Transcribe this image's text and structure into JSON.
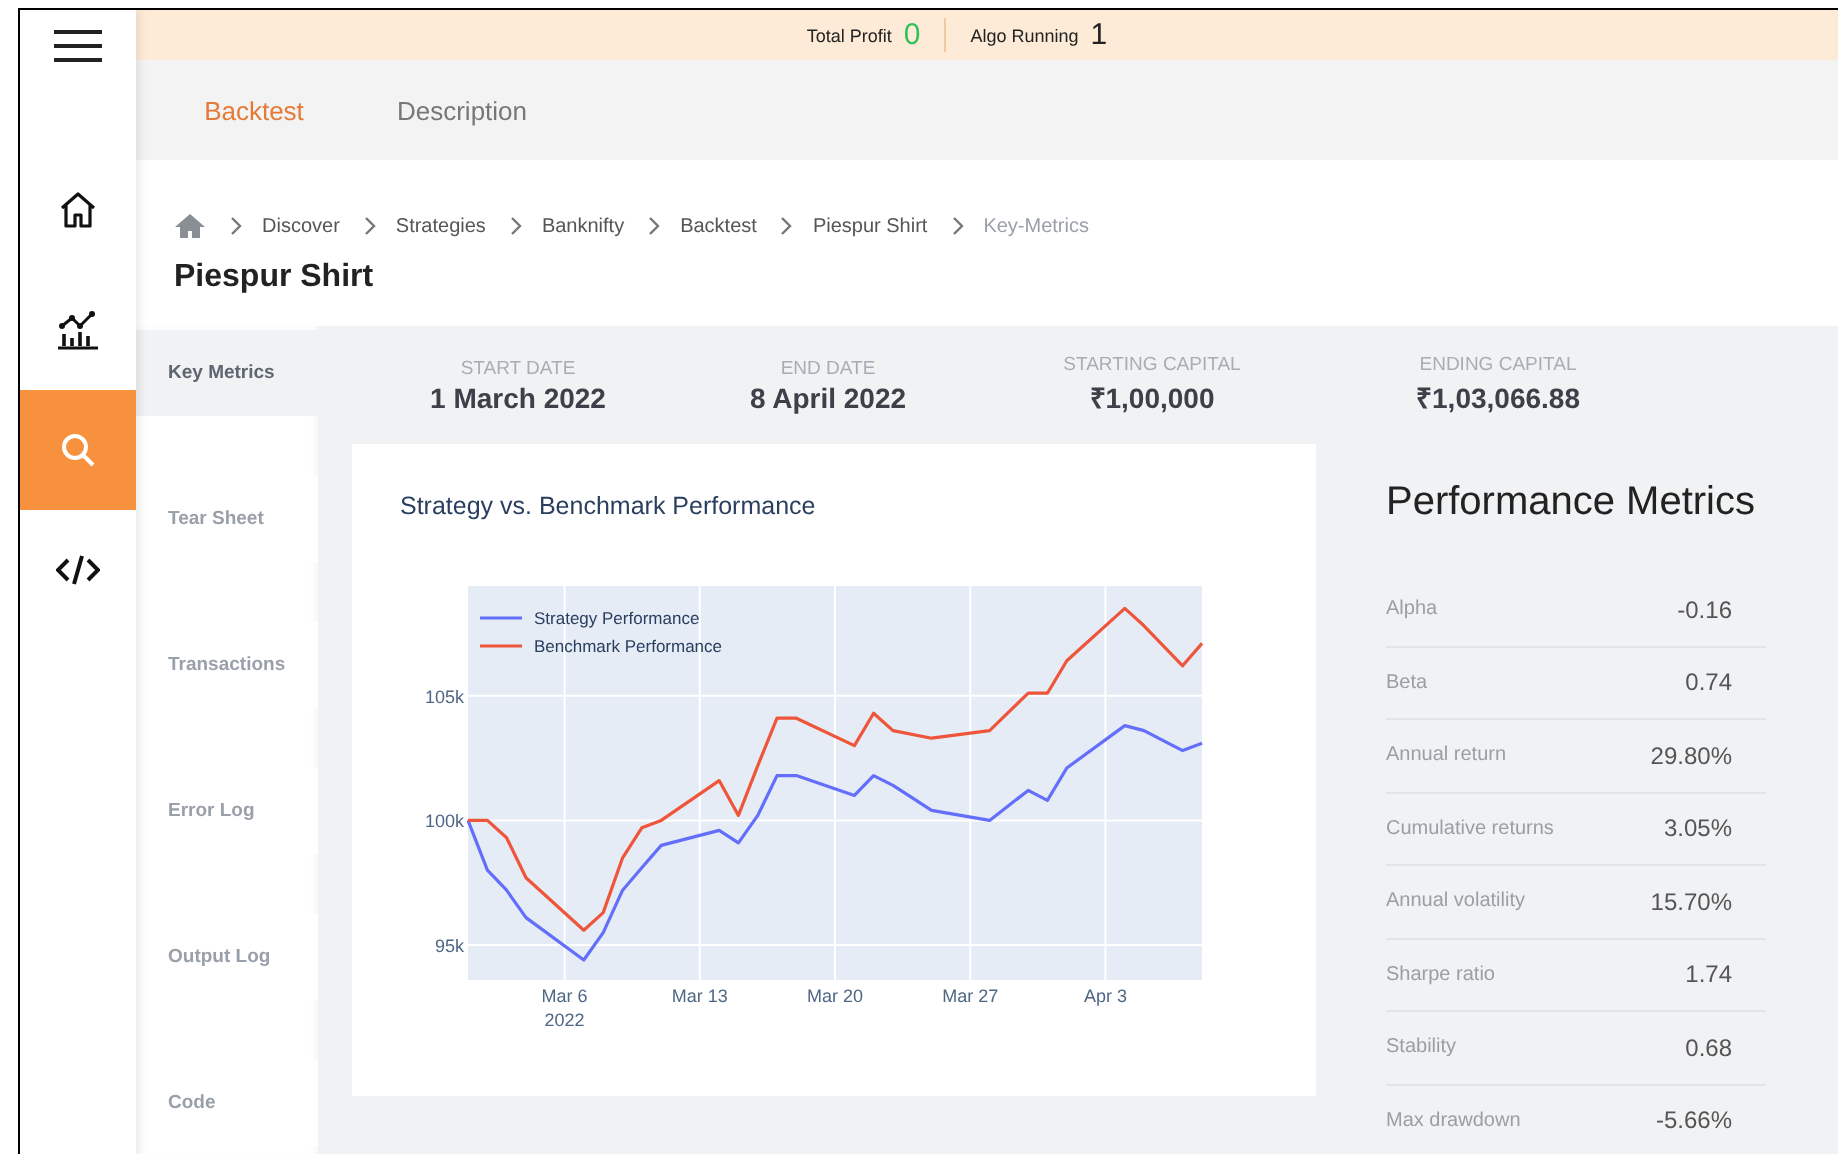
{
  "top_bar": {
    "stats": [
      {
        "label": "Total Profit",
        "value": "0",
        "kind": "profit"
      },
      {
        "label": "Algo Running",
        "value": "1",
        "kind": "count"
      }
    ]
  },
  "nav_rail": {
    "items": [
      {
        "kind": "home",
        "selected": false
      },
      {
        "kind": "chart",
        "selected": false
      },
      {
        "kind": "search",
        "selected": true
      },
      {
        "kind": "code",
        "selected": false
      }
    ]
  },
  "tabs": [
    {
      "label": "Backtest",
      "selected": true
    },
    {
      "label": "Description",
      "selected": false
    }
  ],
  "breadcrumb": [
    {
      "label": "Discover",
      "current": false
    },
    {
      "label": "Strategies",
      "current": false
    },
    {
      "label": "Banknifty",
      "current": false
    },
    {
      "label": "Backtest",
      "current": false
    },
    {
      "label": "Piespur Shirt",
      "current": false
    },
    {
      "label": "Key-Metrics",
      "current": true
    }
  ],
  "page_title": "Piespur Shirt",
  "sections": [
    {
      "label": "Key Metrics",
      "selected": true
    },
    {
      "label": "Tear Sheet",
      "selected": false
    },
    {
      "label": "Transactions",
      "selected": false
    },
    {
      "label": "Error Log",
      "selected": false
    },
    {
      "label": "Output Log",
      "selected": false
    },
    {
      "label": "Code",
      "selected": false
    }
  ],
  "summary": [
    {
      "label": "START DATE",
      "value": "1 March 2022"
    },
    {
      "label": "END DATE",
      "value": "8 April 2022"
    },
    {
      "label": "STARTING CAPITAL",
      "value": "₹1,00,000"
    },
    {
      "label": "ENDING CAPITAL",
      "value": "₹1,03,066.88"
    }
  ],
  "chart_card": {
    "title": "Strategy vs. Benchmark Performance",
    "chart_data": {
      "type": "line",
      "x": [
        "2022-03-01",
        "2022-03-02",
        "2022-03-03",
        "2022-03-04",
        "2022-03-07",
        "2022-03-08",
        "2022-03-09",
        "2022-03-10",
        "2022-03-11",
        "2022-03-14",
        "2022-03-15",
        "2022-03-16",
        "2022-03-17",
        "2022-03-18",
        "2022-03-21",
        "2022-03-22",
        "2022-03-23",
        "2022-03-25",
        "2022-03-28",
        "2022-03-30",
        "2022-03-31",
        "2022-04-01",
        "2022-04-04",
        "2022-04-05",
        "2022-04-07",
        "2022-04-08"
      ],
      "series": [
        {
          "name": "Strategy Performance",
          "color": "#636efa",
          "values": [
            100000,
            98000,
            97200,
            96100,
            94400,
            95500,
            97200,
            98100,
            99000,
            99600,
            99100,
            100200,
            101800,
            101800,
            101000,
            101800,
            101400,
            100400,
            100000,
            101200,
            100800,
            102100,
            103800,
            103600,
            102800,
            103100
          ]
        },
        {
          "name": "Benchmark Performance",
          "color": "#ef553b",
          "values": [
            100000,
            100000,
            99300,
            97700,
            95600,
            96300,
            98500,
            99700,
            100000,
            101600,
            100200,
            102200,
            104100,
            104100,
            103000,
            104300,
            103600,
            103300,
            103600,
            105100,
            105100,
            106400,
            108500,
            107800,
            106200,
            107100
          ]
        }
      ],
      "grid": {
        "x": true,
        "y": true
      },
      "legend": true,
      "xlim": [
        "2022-03-01",
        "2022-04-08"
      ],
      "ylim": [
        93600,
        109400
      ],
      "xticks": [
        {
          "value": "2022-03-06",
          "label": "Mar 6\n2022"
        },
        {
          "value": "2022-03-13",
          "label": "Mar 13"
        },
        {
          "value": "2022-03-20",
          "label": "Mar 20"
        },
        {
          "value": "2022-03-27",
          "label": "Mar 27"
        },
        {
          "value": "2022-04-03",
          "label": "Apr 3"
        }
      ],
      "yticks": [
        {
          "value": 95000,
          "label": "95k"
        },
        {
          "value": 100000,
          "label": "100k"
        },
        {
          "value": 105000,
          "label": "105k"
        }
      ]
    }
  },
  "performance_metrics": {
    "title": "Performance Metrics",
    "rows": [
      {
        "label": "Alpha",
        "value": "-0.16"
      },
      {
        "label": "Beta",
        "value": "0.74"
      },
      {
        "label": "Annual return",
        "value": "29.80%"
      },
      {
        "label": "Cumulative returns",
        "value": "3.05%"
      },
      {
        "label": "Annual volatility",
        "value": "15.70%"
      },
      {
        "label": "Sharpe ratio",
        "value": "1.74"
      },
      {
        "label": "Stability",
        "value": "0.68"
      },
      {
        "label": "Max drawdown",
        "value": "-5.66%"
      }
    ]
  }
}
